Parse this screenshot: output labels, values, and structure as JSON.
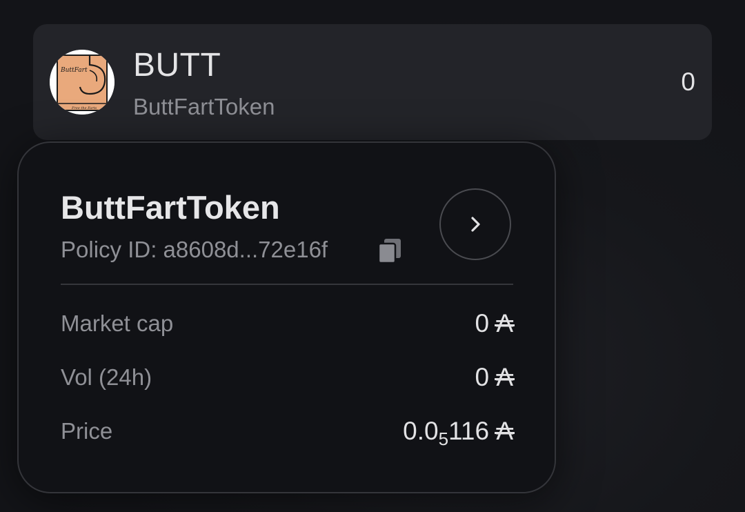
{
  "token": {
    "symbol": "BUTT",
    "name": "ButtFartToken",
    "balance": "0",
    "logo_text_top": "ButtFart",
    "logo_text_bottom": "Free the Farts"
  },
  "card": {
    "title": "ButtFartToken",
    "policy_id": "Policy ID: a8608d...72e16f",
    "copy_icon": "copy-icon",
    "nav_icon": "chevron-right-icon",
    "stats": [
      {
        "label": "Market cap",
        "value": "0",
        "unit": "₳"
      },
      {
        "label": "Vol (24h)",
        "value": "0",
        "unit": "₳"
      },
      {
        "label": "Price",
        "value_prefix": "0.0",
        "value_sub": "5",
        "value_suffix": "116",
        "unit": "₳"
      }
    ]
  }
}
